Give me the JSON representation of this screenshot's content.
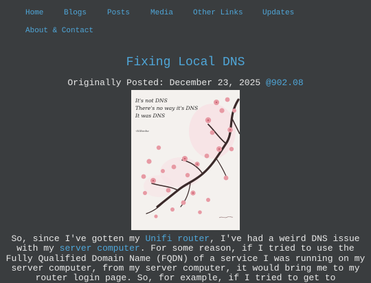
{
  "nav": {
    "items": [
      "Home",
      "Blogs",
      "Posts",
      "Media",
      "Other Links",
      "Updates",
      "About & Contact"
    ]
  },
  "post": {
    "title": "Fixing Local DNS",
    "posted_label": "Originally Posted: December 23, 2025",
    "posted_stamp": "@902.08"
  },
  "image": {
    "caption_lines": [
      "It's not DNS",
      "There's no way it's DNS",
      "It was DNS"
    ],
    "signature": "-SSBonba"
  },
  "body": {
    "seg1": "So, since I've gotten my ",
    "link1": "Unifi router",
    "seg2": ", I've had a weird DNS issue with my ",
    "link2": "server computer",
    "seg3": ". For some reason, if I tried to use the Fully Qualified Domain Name (FQDN) of a service I was running on my server computer, from my server computer, it would bring me to my router login page. So, for example, if I tried to get to"
  },
  "colors": {
    "background": "#3a3d3f",
    "link": "#4fa6d8",
    "text": "#e6e6e6"
  }
}
